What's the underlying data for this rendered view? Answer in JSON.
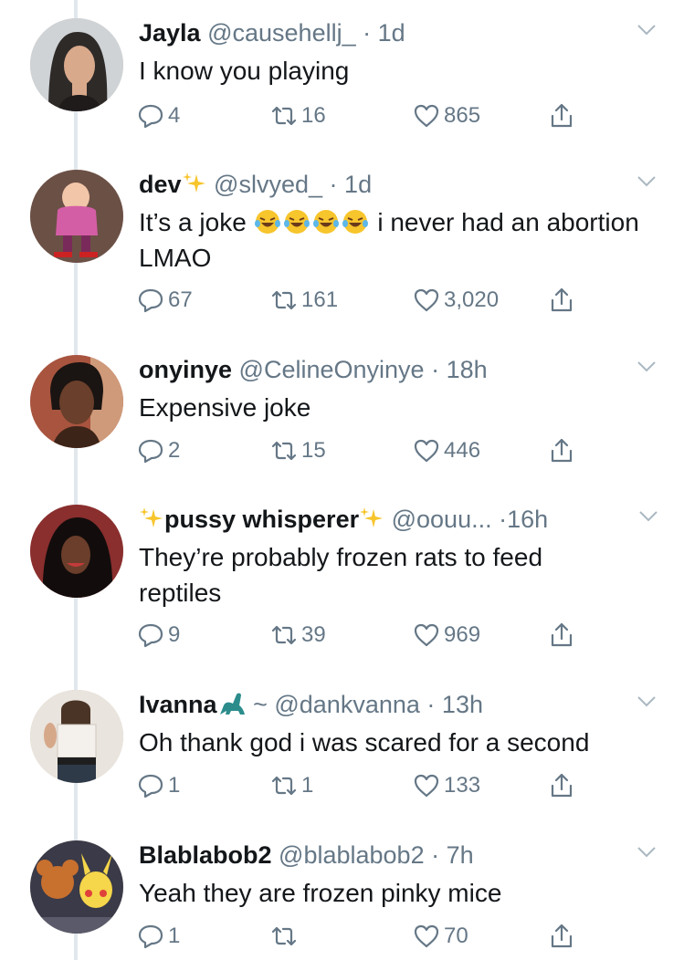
{
  "colors": {
    "text": "#14171a",
    "muted": "#657786",
    "line": "#e1e8ed",
    "emoji": "#f7c52c"
  },
  "tweets": [
    {
      "name": "Jayla",
      "handle": "@causehellj_",
      "dot": "·",
      "time": "1d",
      "text": "I know you playing",
      "replies": "4",
      "retweets": "16",
      "likes": "865",
      "avatar_icon": "woman-portrait-avatar"
    },
    {
      "name": "dev",
      "name_suffix_icon": "sparkles-emoji",
      "handle": "@slvyed_",
      "dot": "·",
      "time": "1d",
      "text_before": "It’s a joke",
      "text_emoji": "laughing-tears-emoji x4",
      "text_after": "i never had an abortion LMAO",
      "replies": "67",
      "retweets": "161",
      "likes": "3,020",
      "avatar_icon": "cartoon-character-avatar"
    },
    {
      "name": "onyinye",
      "handle": "@CelineOnyinye",
      "dot": "·",
      "time": "18h",
      "text": "Expensive joke",
      "replies": "2",
      "retweets": "15",
      "likes": "446",
      "avatar_icon": "woman-selfie-avatar"
    },
    {
      "name": "pussy whisperer",
      "name_prefix_icon": "sparkles-emoji",
      "name_suffix_icon": "sparkles-emoji",
      "handle": "@oouu...",
      "dot": "·",
      "time": "16h",
      "text": "They’re probably frozen rats to feed reptiles",
      "replies": "9",
      "retweets": "39",
      "likes": "969",
      "avatar_icon": "woman-dark-hair-avatar"
    },
    {
      "name": "Ivanna",
      "name_suffix_icon": "dinosaur-emoji",
      "name_suffix_text": "~",
      "handle": "@dankvanna",
      "dot": "·",
      "time": "13h",
      "text": "Oh thank god i was scared for a second",
      "replies": "1",
      "retweets": "1",
      "likes": "133",
      "avatar_icon": "mirror-selfie-avatar"
    },
    {
      "name": "Blablabob2",
      "handle": "@blablabob2",
      "dot": "·",
      "time": "7h",
      "text": "Yeah they are frozen pinky mice",
      "replies": "1",
      "retweets": "",
      "likes": "70",
      "avatar_icon": "cartoon-mouse-pikachu-avatar"
    }
  ]
}
